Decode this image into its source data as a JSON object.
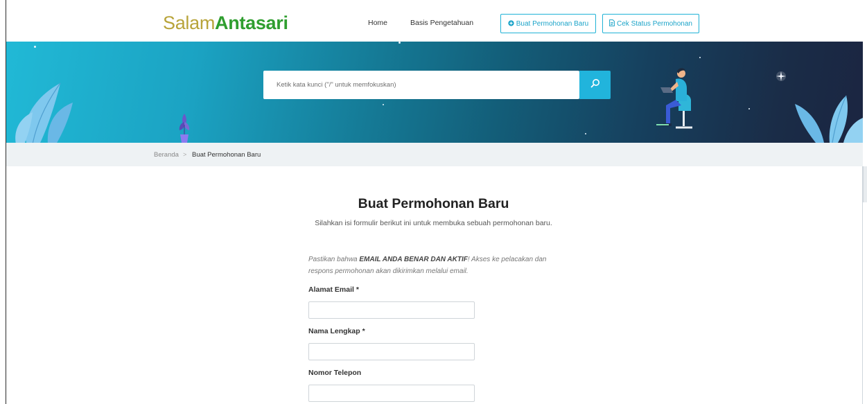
{
  "header": {
    "logo_part1": "Salam",
    "logo_part2": "Antasari",
    "nav": [
      {
        "label": "Home"
      },
      {
        "label": "Basis Pengetahuan"
      }
    ],
    "new_request_button": "Buat Permohonan Baru",
    "check_status_button": "Cek Status Permohonan"
  },
  "hero": {
    "search_placeholder": "Ketik kata kunci (\"/\" untuk memfokuskan)",
    "search_icon": "search-icon"
  },
  "breadcrumb": {
    "home": "Beranda",
    "separator": ">",
    "current": "Buat Permohonan Baru"
  },
  "form": {
    "title": "Buat Permohonan Baru",
    "subtitle": "Silahkan isi formulir berikut ini untuk membuka sebuah permohonan baru.",
    "note_prefix": "Pastikan bahwa ",
    "note_emphasis": "EMAIL ANDA BENAR DAN AKTIF",
    "note_suffix": "! Akses ke pelacakan dan respons permohonan akan dikirimkan melalui email.",
    "fields": [
      {
        "label": "Alamat Email *",
        "value": ""
      },
      {
        "label": "Nama Lengkap *",
        "value": ""
      },
      {
        "label": "Nomor Telepon",
        "value": ""
      }
    ]
  },
  "colors": {
    "accent": "#21b4dc",
    "logo_green": "#2f9e2f",
    "logo_gold": "#b8a43a"
  }
}
